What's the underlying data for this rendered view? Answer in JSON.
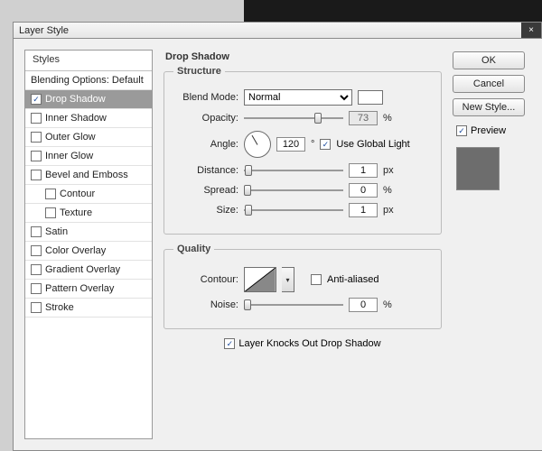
{
  "window": {
    "title": "Layer Style",
    "close": "×"
  },
  "sidebar": {
    "header": "Styles",
    "blending": "Blending Options: Default",
    "items": [
      {
        "label": "Drop Shadow",
        "checked": true,
        "selected": true,
        "indent": false
      },
      {
        "label": "Inner Shadow",
        "checked": false,
        "selected": false,
        "indent": false
      },
      {
        "label": "Outer Glow",
        "checked": false,
        "selected": false,
        "indent": false
      },
      {
        "label": "Inner Glow",
        "checked": false,
        "selected": false,
        "indent": false
      },
      {
        "label": "Bevel and Emboss",
        "checked": false,
        "selected": false,
        "indent": false
      },
      {
        "label": "Contour",
        "checked": false,
        "selected": false,
        "indent": true
      },
      {
        "label": "Texture",
        "checked": false,
        "selected": false,
        "indent": true
      },
      {
        "label": "Satin",
        "checked": false,
        "selected": false,
        "indent": false
      },
      {
        "label": "Color Overlay",
        "checked": false,
        "selected": false,
        "indent": false
      },
      {
        "label": "Gradient Overlay",
        "checked": false,
        "selected": false,
        "indent": false
      },
      {
        "label": "Pattern Overlay",
        "checked": false,
        "selected": false,
        "indent": false
      },
      {
        "label": "Stroke",
        "checked": false,
        "selected": false,
        "indent": false
      }
    ]
  },
  "main": {
    "heading": "Drop Shadow",
    "structure": {
      "legend": "Structure",
      "blend_label": "Blend Mode:",
      "blend_value": "Normal",
      "opacity_label": "Opacity:",
      "opacity_value": "73",
      "opacity_unit": "%",
      "angle_label": "Angle:",
      "angle_value": "120",
      "angle_unit": "°",
      "global_label": "Use Global Light",
      "global_checked": true,
      "distance_label": "Distance:",
      "distance_value": "1",
      "distance_unit": "px",
      "spread_label": "Spread:",
      "spread_value": "0",
      "spread_unit": "%",
      "size_label": "Size:",
      "size_value": "1",
      "size_unit": "px"
    },
    "quality": {
      "legend": "Quality",
      "contour_label": "Contour:",
      "aa_label": "Anti-aliased",
      "aa_checked": false,
      "noise_label": "Noise:",
      "noise_value": "0",
      "noise_unit": "%"
    },
    "knockout_label": "Layer Knocks Out Drop Shadow",
    "knockout_checked": true
  },
  "actions": {
    "ok": "OK",
    "cancel": "Cancel",
    "newstyle": "New Style...",
    "preview_label": "Preview",
    "preview_checked": true,
    "preview_color": "#6d6d6d"
  }
}
